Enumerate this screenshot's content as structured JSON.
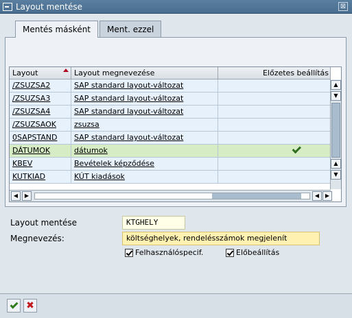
{
  "window": {
    "title": "Layout mentése",
    "close_glyph": "⊠"
  },
  "tabs": [
    {
      "label": "Mentés másként",
      "active": true
    },
    {
      "label": "Ment. ezzel",
      "active": false
    }
  ],
  "table": {
    "columns": [
      "Layout",
      "Layout megnevezése",
      "Előzetes beállítás"
    ],
    "rows": [
      {
        "layout": "/ZSUZSA2",
        "name": "SAP standard layout-változat",
        "default": false
      },
      {
        "layout": "/ZSUZSA3",
        "name": "SAP standard layout-változat",
        "default": false
      },
      {
        "layout": "/ZSUZSA4",
        "name": "SAP standard layout-változat",
        "default": false
      },
      {
        "layout": "/ZSUZSAOK",
        "name": "zsuzsa",
        "default": false
      },
      {
        "layout": "0SAPSTAND",
        "name": "SAP standard layout-változat",
        "default": false
      },
      {
        "layout": "DÁTUMOK",
        "name": "dátumok",
        "default": true
      },
      {
        "layout": "KBEV",
        "name": "Bevételek képződése",
        "default": false
      },
      {
        "layout": "KUTKIAD",
        "name": "KÚT kiadások",
        "default": false
      }
    ]
  },
  "form": {
    "layout_label": "Layout mentése",
    "layout_value": "KTGHELY",
    "desc_label": "Megnevezés:",
    "desc_value": "költséghelyek, rendelésszámok megjelenít",
    "cb_user_specific": "Felhasználóspecif.",
    "cb_default": "Előbeállítás"
  },
  "colors": {
    "accent": "#5a7e9f",
    "selected_row": "#d6ecc4",
    "ok": "#2f7a1f",
    "cancel": "#c0181c"
  }
}
